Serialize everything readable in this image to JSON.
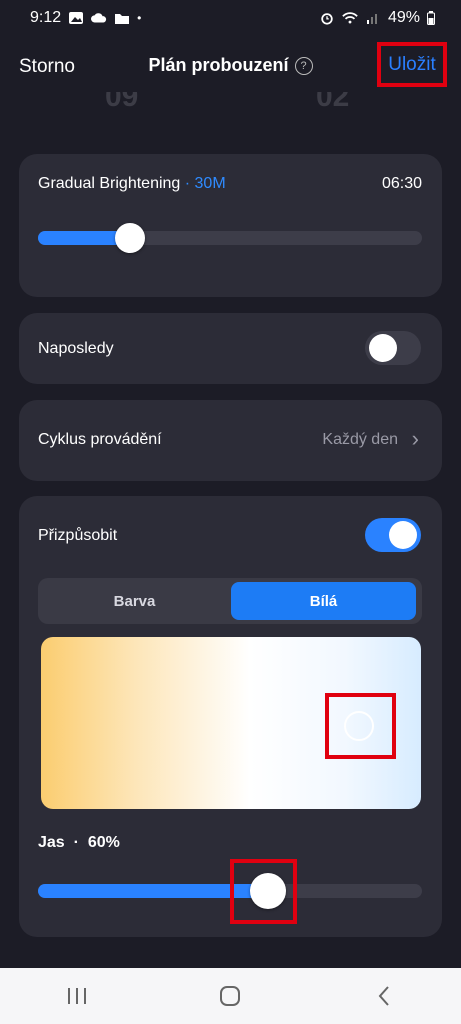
{
  "status_bar": {
    "time": "9:12",
    "dot": "•",
    "battery": "49%",
    "left_icons": [
      "gallery-icon",
      "cloud-icon",
      "folder-icon"
    ],
    "right_icons": [
      "alarm-icon",
      "wifi-icon",
      "signal-icon",
      "battery-icon"
    ]
  },
  "header": {
    "cancel_label": "Storno",
    "title": "Plán probouzení",
    "help_glyph": "?",
    "save_label": "Uložit"
  },
  "time_picker": {
    "hour": "09",
    "minute": "02"
  },
  "brightening": {
    "label": "Gradual Brightening",
    "separator": " · ",
    "duration": "30M",
    "time": "06:30",
    "slider_fraction": 0.24
  },
  "last": {
    "label": "Naposledy",
    "on": false
  },
  "cycle": {
    "label": "Cyklus provádění",
    "value": "Každý den",
    "chevron": "›"
  },
  "customize": {
    "label": "Přizpůsobit",
    "on": true,
    "tabs": [
      {
        "label": "Barva",
        "selected": false
      },
      {
        "label": "Bílá",
        "selected": true
      }
    ],
    "brightness_label": "Jas",
    "brightness_separator": "·",
    "brightness_value": "60%",
    "brightness_fraction": 0.6
  },
  "colors": {
    "accent": "#2a82ff",
    "link": "#2a7fff",
    "card": "#2c2c37",
    "background": "#1c1c26",
    "highlight": "#e00010"
  },
  "bottom_nav": {
    "icons": [
      "recents-icon",
      "home-icon",
      "back-icon"
    ]
  }
}
